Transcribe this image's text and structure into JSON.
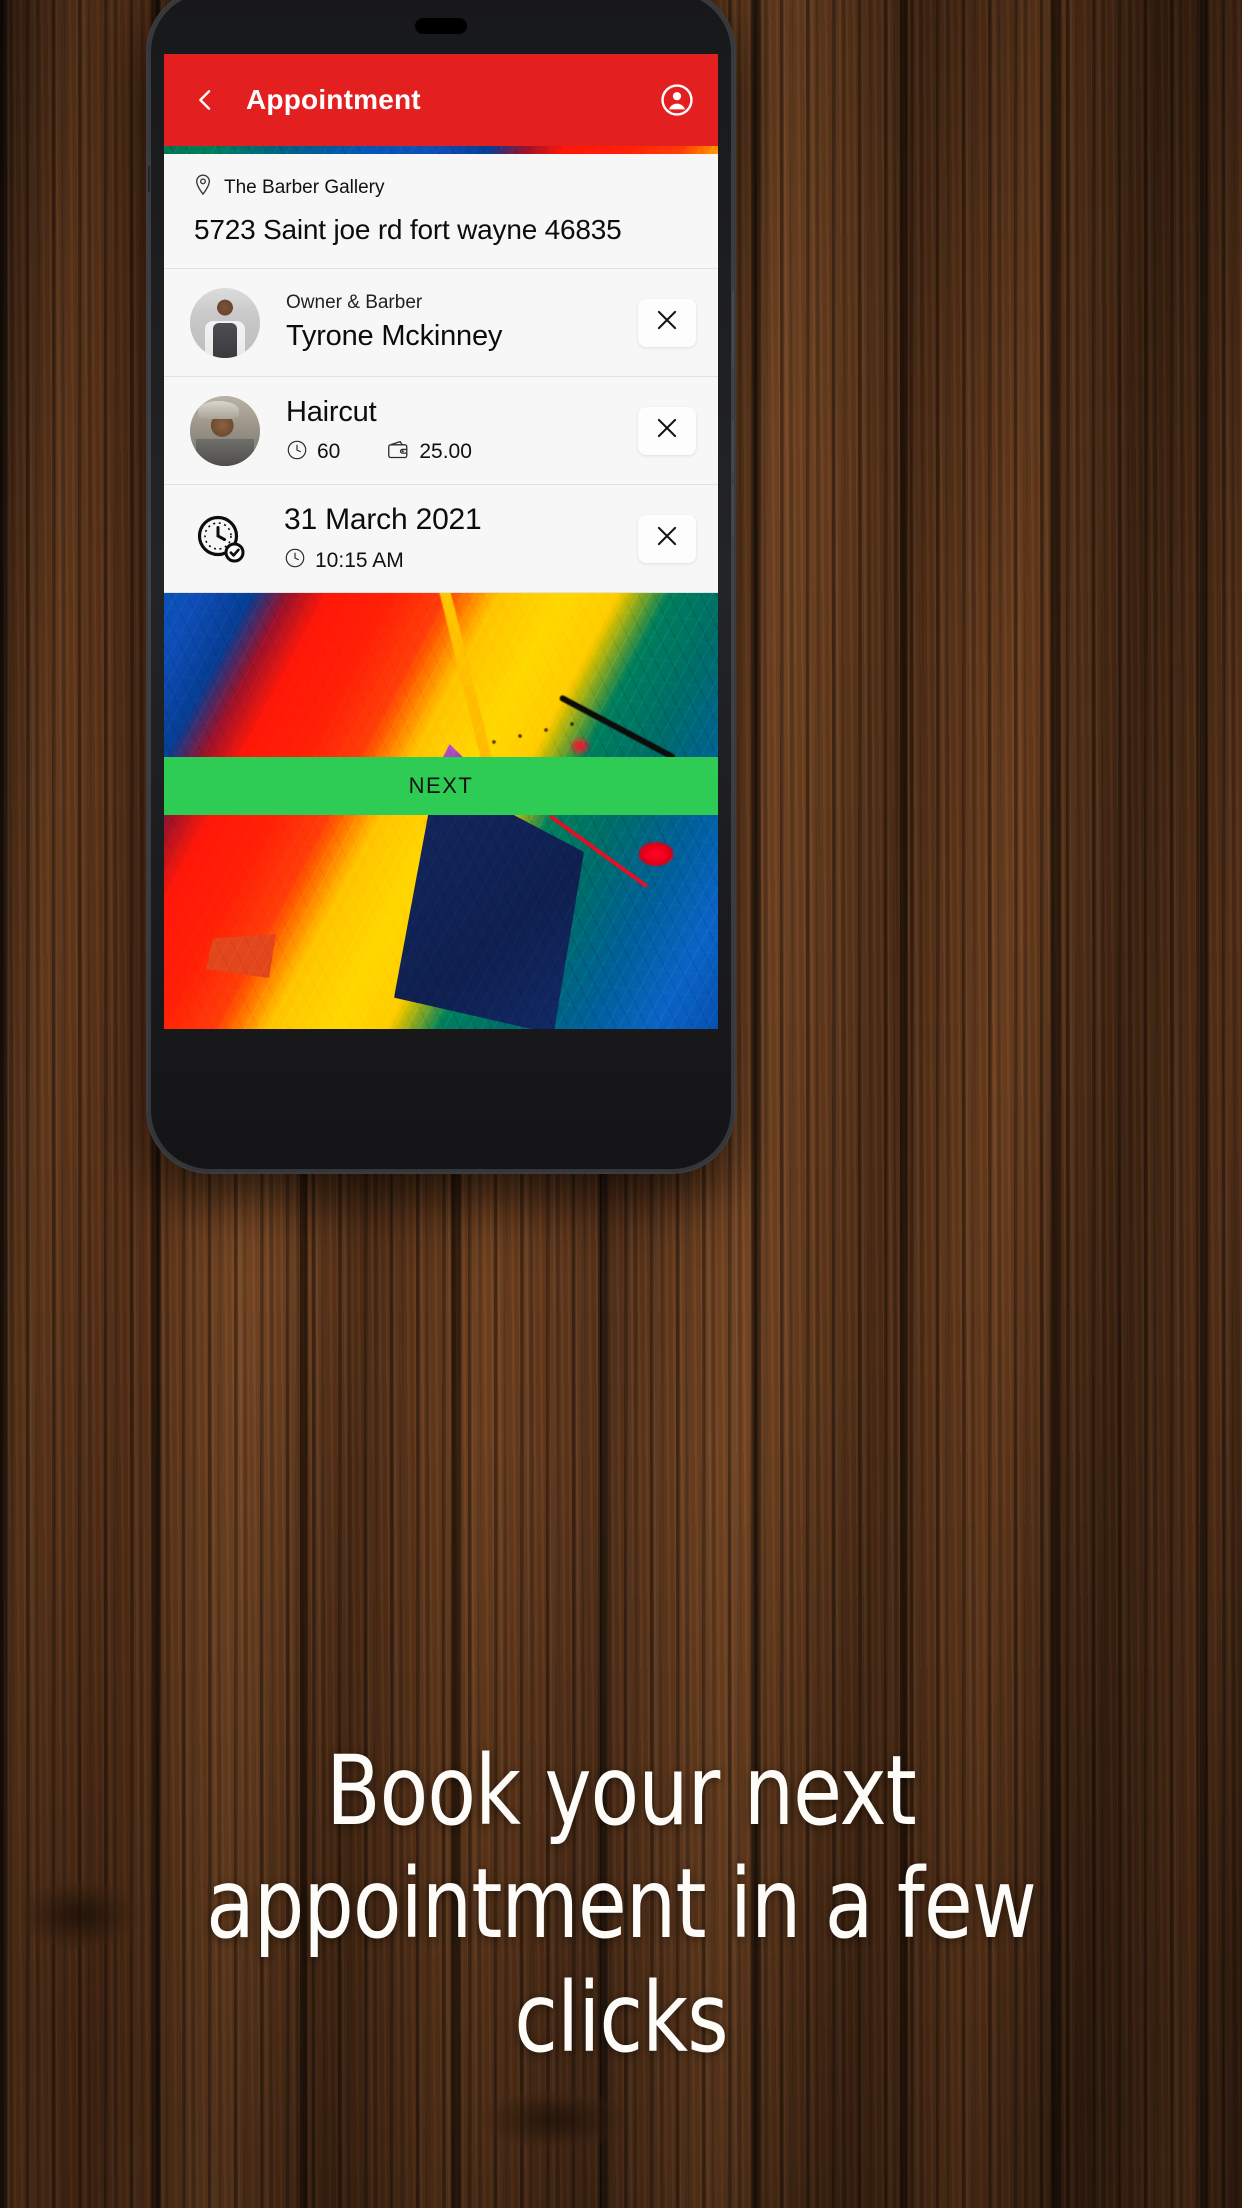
{
  "appbar": {
    "title": "Appointment",
    "back_icon": "chevron-left-icon",
    "account_icon": "account-circle-icon",
    "background_color": "#e41f20"
  },
  "venue": {
    "location_icon": "location-pin-icon",
    "name": "The Barber Gallery",
    "address": "5723 Saint joe rd fort wayne 46835"
  },
  "rows": [
    {
      "role_label": "Owner & Barber",
      "title": "Tyrone Mckinney",
      "thumb_icon": "barber-portrait-avatar",
      "close_icon": "close-icon"
    },
    {
      "title": "Haircut",
      "duration_icon": "clock-icon",
      "duration": "60",
      "price_icon": "wallet-icon",
      "price": "25.00",
      "thumb_icon": "haircut-photo-avatar",
      "close_icon": "close-icon"
    }
  ],
  "datetime": {
    "icon": "clock-check-icon",
    "date": "31 March 2021",
    "time_icon": "clock-icon",
    "time": "10:15 AM",
    "close_icon": "close-icon"
  },
  "next_button": {
    "label": "NEXT",
    "background_color": "#2ecc55"
  },
  "caption": {
    "text": "Book your next appointment in a few clicks"
  }
}
